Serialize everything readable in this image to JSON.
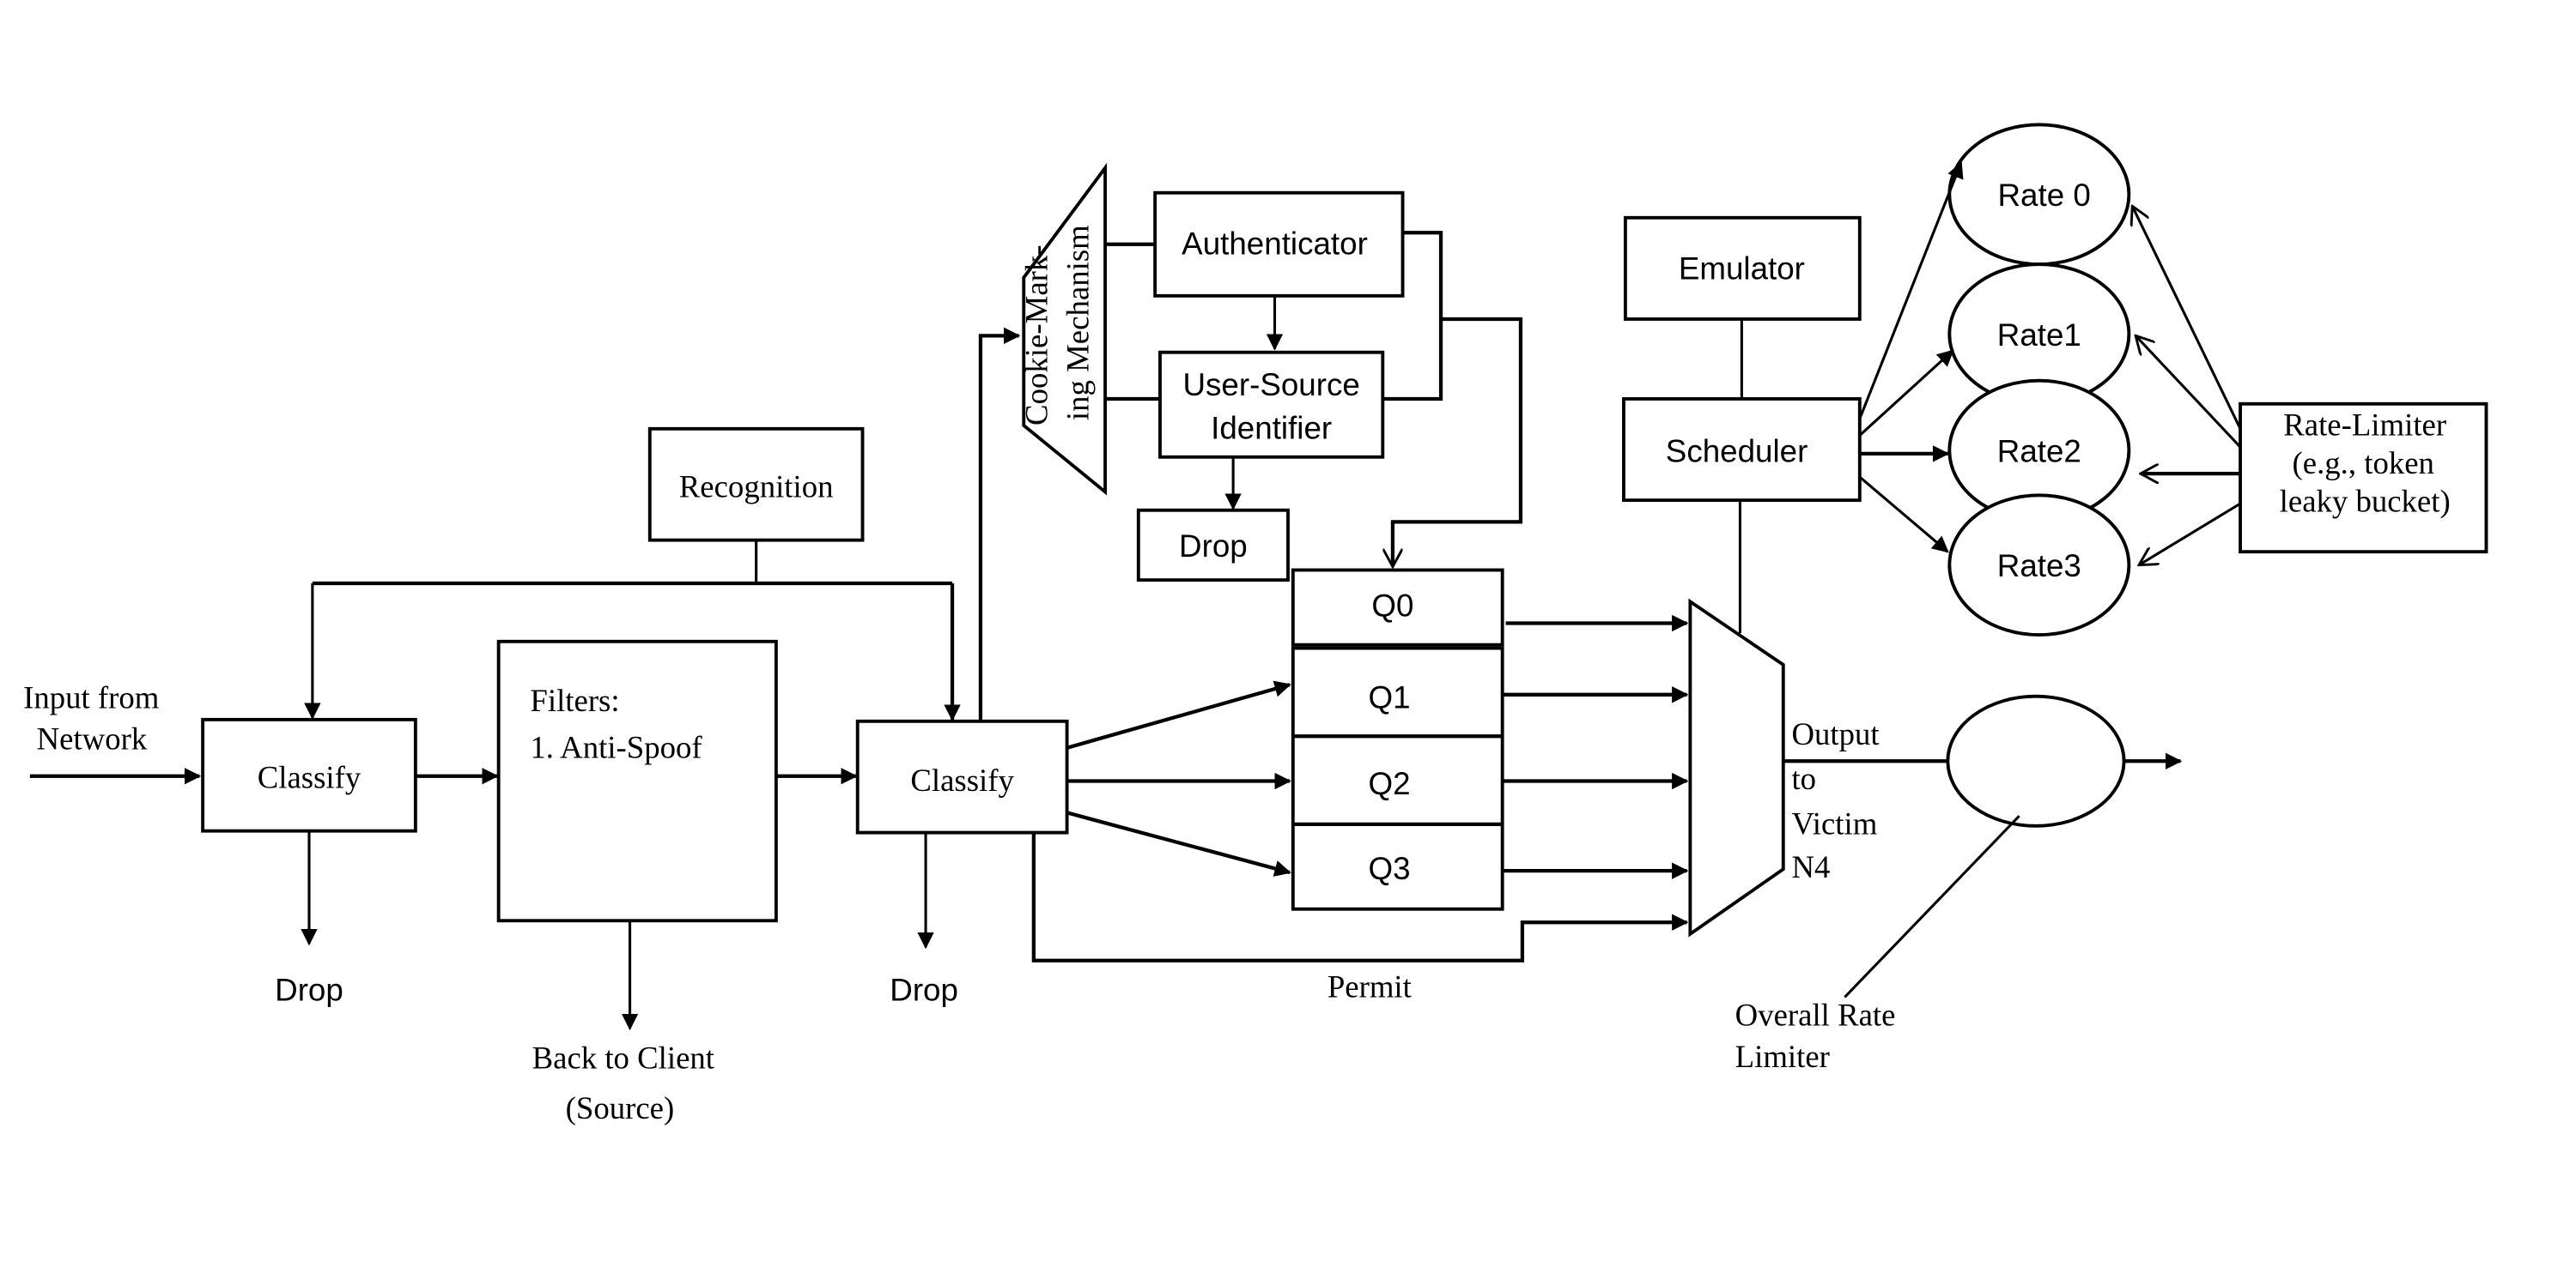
{
  "diagram": {
    "input_label_line1": "Input from",
    "input_label_line2": "Network",
    "classify1": "Classify",
    "classify2": "Classify",
    "recognition": "Recognition",
    "filters_title": "Filters:",
    "filters_item1": "1.  Anti-Spoof",
    "drop_left": "Drop",
    "drop_mid": "Drop",
    "drop_top": "Drop",
    "back_to_client_line1": "Back to Client",
    "back_to_client_line2": "(Source)",
    "cookie_line1": "Cookie-Mark-",
    "cookie_line2": "ing Mechanism",
    "authenticator": "Authenticator",
    "user_source_line1": "User-Source",
    "user_source_line2": "Identifier",
    "queues": [
      "Q0",
      "Q1",
      "Q2",
      "Q3"
    ],
    "permit": "Permit",
    "emulator": "Emulator",
    "scheduler": "Scheduler",
    "rates": [
      "Rate 0",
      "Rate1",
      "Rate2",
      "Rate3"
    ],
    "rate_limiter_line1": "Rate-Limiter",
    "rate_limiter_line2": "(e.g., token",
    "rate_limiter_line3": "leaky bucket)",
    "output_line1": "Output",
    "output_line2": "to",
    "output_line3": "Victim",
    "output_line4": "N4",
    "overall_line1": "Overall Rate",
    "overall_line2": "Limiter"
  }
}
